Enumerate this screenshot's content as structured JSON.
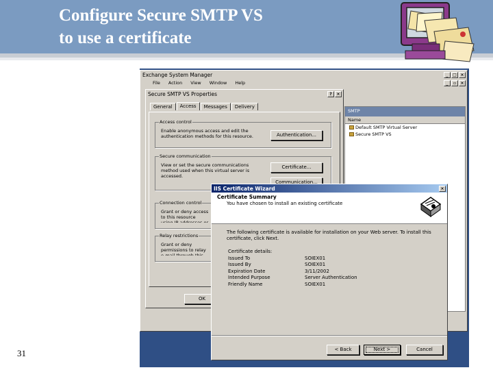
{
  "slide": {
    "title": "Configure Secure SMTP VS\nto use a certificate",
    "number": "31"
  },
  "esm": {
    "title": "Exchange System Manager",
    "menu": [
      "File",
      "Action",
      "View",
      "Window",
      "Help"
    ],
    "right_header": "SMTP",
    "column_name": "Name",
    "items": [
      "Default SMTP Virtual Server",
      "Secure SMTP VS"
    ]
  },
  "props": {
    "title": "Secure SMTP VS Properties",
    "tabs": [
      "General",
      "Access",
      "Messages",
      "Delivery"
    ],
    "groups": {
      "access_control": {
        "label": "Access control",
        "text": "Enable anonymous access and edit the authentication methods for this resource.",
        "button": "Authentication..."
      },
      "secure_comm": {
        "label": "Secure communication",
        "text": "View or set the secure communications method used when this virtual server is accessed.",
        "button1": "Certificate...",
        "button2": "Communication..."
      },
      "connection": {
        "label": "Connection control",
        "text": "Grant or deny access to this resource using IP addresses or Internet domain names."
      },
      "relay": {
        "label": "Relay restrictions",
        "text": "Grant or deny permissions to relay e-mail through this SMTP virtual server."
      }
    },
    "ok_button": "OK"
  },
  "wizard": {
    "title": "IIS Certificate Wizard",
    "heading": "Certificate Summary",
    "subheading": "You have chosen to install an existing certificate",
    "body": "The following certificate is available for installation on your Web server. To install this certificate, click Next.",
    "details_label": "Certificate details:",
    "details": [
      {
        "key": "Issued To",
        "value": "SOIEX01"
      },
      {
        "key": "Issued By",
        "value": "SOIEX01"
      },
      {
        "key": "Expiration Date",
        "value": "3/11/2002"
      },
      {
        "key": "Intended Purpose",
        "value": "Server Authentication"
      },
      {
        "key": "Friendly Name",
        "value": "SOIEX01"
      }
    ],
    "buttons": {
      "back": "< Back",
      "next": "Next >",
      "cancel": "Cancel"
    }
  },
  "colors": {
    "title_bar": "#7b9bc1",
    "caption_active": "#0a246a",
    "desktop": "#2f4f85"
  }
}
